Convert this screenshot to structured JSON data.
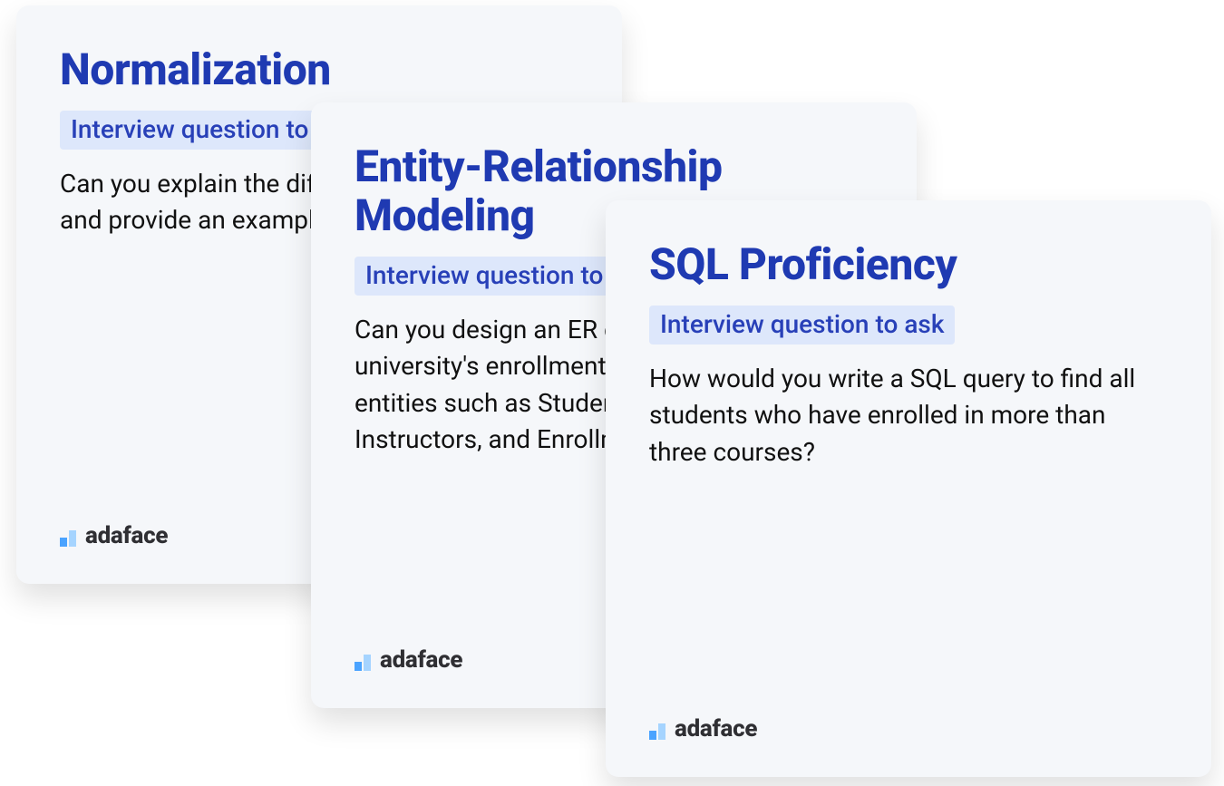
{
  "cards": [
    {
      "title": "Normalization",
      "badge": "Interview question to ask",
      "question": "Can you explain the different normal forms and provide an example for each?",
      "brand": "adaface"
    },
    {
      "title": "Entity-Relationship Modeling",
      "badge": "Interview question to ask",
      "question": "Can you design an ER diagram to model a university's enrollment system, including entities such as Students, Courses, Instructors, and Enrollments?",
      "brand": "adaface"
    },
    {
      "title": "SQL Proficiency",
      "badge": "Interview question to ask",
      "question": "How would you write a SQL query to find all students who have enrolled in more than three courses?",
      "brand": "adaface"
    }
  ]
}
